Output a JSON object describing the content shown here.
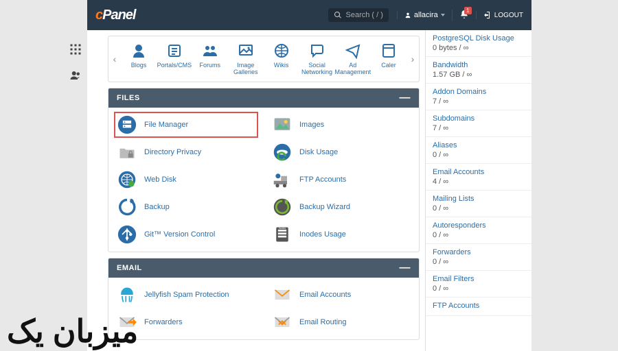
{
  "header": {
    "brand_prefix": "c",
    "brand_rest": "Panel",
    "search_placeholder": "Search ( / )",
    "username": "allacira",
    "notif_count": "1",
    "logout": "LOGOUT"
  },
  "toolbar": {
    "items": [
      {
        "label": "Blogs"
      },
      {
        "label": "Portals/CMS"
      },
      {
        "label": "Forums"
      },
      {
        "label": "Image Galleries"
      },
      {
        "label": "Wikis"
      },
      {
        "label": "Social Networking"
      },
      {
        "label": "Ad Management"
      },
      {
        "label": "Caler"
      }
    ]
  },
  "panels": {
    "files": {
      "title": "FILES",
      "items": [
        {
          "label": "File Manager",
          "highlight": true
        },
        {
          "label": "Images"
        },
        {
          "label": "Directory Privacy"
        },
        {
          "label": "Disk Usage"
        },
        {
          "label": "Web Disk"
        },
        {
          "label": "FTP Accounts"
        },
        {
          "label": "Backup"
        },
        {
          "label": "Backup Wizard"
        },
        {
          "label": "Git™ Version Control"
        },
        {
          "label": "Inodes Usage"
        }
      ]
    },
    "email": {
      "title": "EMAIL",
      "items": [
        {
          "label": "Jellyfish Spam Protection"
        },
        {
          "label": "Email Accounts"
        },
        {
          "label": "Forwarders"
        },
        {
          "label": "Email Routing"
        }
      ]
    }
  },
  "stats": [
    {
      "label": "PostgreSQL Disk Usage",
      "value": "0 bytes / ∞"
    },
    {
      "label": "Bandwidth",
      "value": "1.57 GB / ∞"
    },
    {
      "label": "Addon Domains",
      "value": "7 / ∞"
    },
    {
      "label": "Subdomains",
      "value": "7 / ∞"
    },
    {
      "label": "Aliases",
      "value": "0 / ∞"
    },
    {
      "label": "Email Accounts",
      "value": "4 / ∞"
    },
    {
      "label": "Mailing Lists",
      "value": "0 / ∞"
    },
    {
      "label": "Autoresponders",
      "value": "0 / ∞"
    },
    {
      "label": "Forwarders",
      "value": "0 / ∞"
    },
    {
      "label": "Email Filters",
      "value": "0 / ∞"
    },
    {
      "label": "FTP Accounts",
      "value": ""
    }
  ],
  "watermark": "میزبان یک"
}
